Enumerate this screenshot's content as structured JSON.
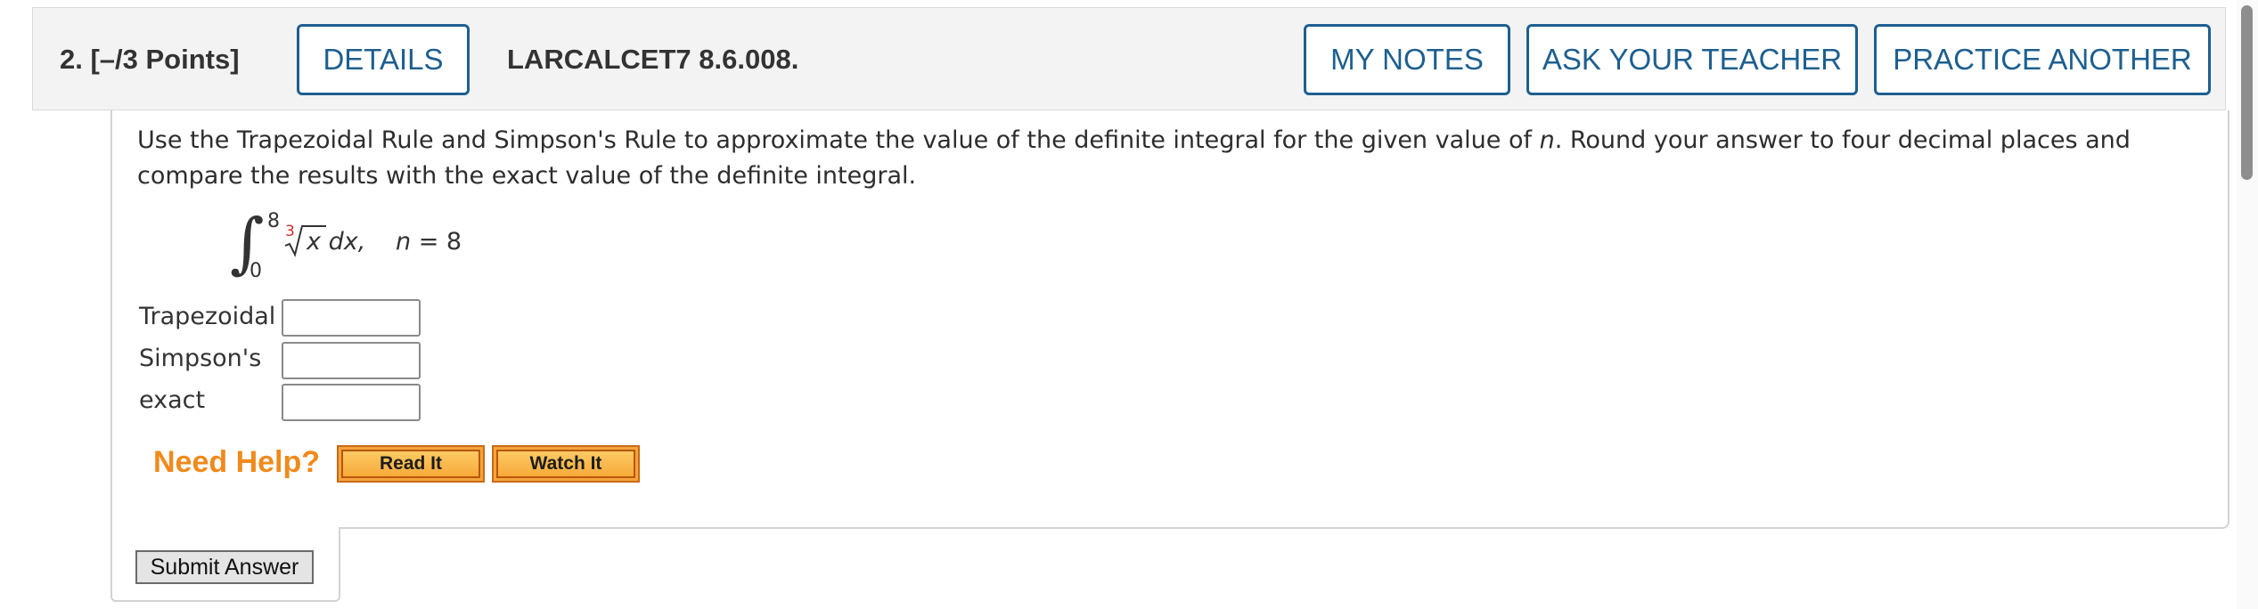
{
  "question": {
    "number_points": "2.  [–/3 Points]",
    "id": "LARCALCET7 8.6.008.",
    "buttons": {
      "details": "DETAILS",
      "my_notes": "MY NOTES",
      "ask_teacher": "ASK YOUR TEACHER",
      "practice_another": "PRACTICE ANOTHER"
    }
  },
  "problem": {
    "text_before_n": "Use the Trapezoidal Rule and Simpson's Rule to approximate the value of the definite integral for the given value of ",
    "n_var": "n",
    "text_after_n": ". Round your answer to four decimal places and compare the results with the exact value of the definite integral."
  },
  "integral": {
    "upper_limit": "8",
    "lower_limit": "0",
    "root_index": "3",
    "radicand": "x",
    "differential": "dx,",
    "n_label": "n",
    "n_value": "= 8"
  },
  "answers": [
    {
      "label": "Trapezoidal",
      "value": ""
    },
    {
      "label": "Simpson's",
      "value": ""
    },
    {
      "label": "exact",
      "value": ""
    }
  ],
  "help": {
    "title": "Need Help?",
    "read_it": "Read It",
    "watch_it": "Watch It"
  },
  "submit_label": "Submit Answer",
  "colors": {
    "accent": "#1d5f8f",
    "help_orange": "#f08a1c",
    "root_index_red": "#d62c2c"
  }
}
